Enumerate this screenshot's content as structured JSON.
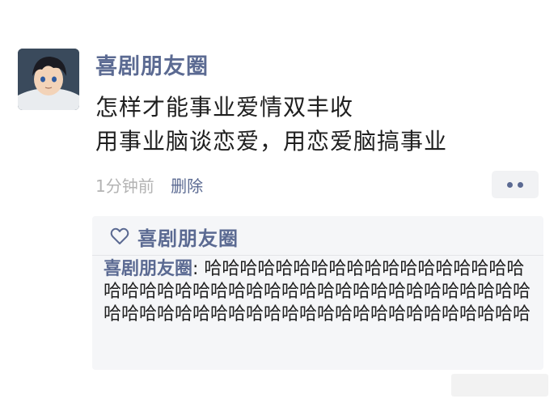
{
  "post": {
    "author": "喜剧朋友圈",
    "lines": [
      "怎样才能事业爱情双丰收",
      "用事业脑谈恋爱，用恋爱脑搞事业"
    ],
    "time": "1分钟前",
    "delete_label": "删除"
  },
  "likes": {
    "icon": "heart-outline-icon",
    "names": "喜剧朋友圈"
  },
  "comment": {
    "author": "喜剧朋友圈",
    "separator": ": ",
    "text": "哈哈哈哈哈哈哈哈哈哈哈哈哈哈哈哈哈哈哈哈哈哈哈哈哈哈哈哈哈哈哈哈哈哈哈哈哈哈哈哈哈哈哈哈哈哈哈哈哈哈哈哈哈哈哈哈哈哈哈哈哈哈哈哈哈哈"
  },
  "colors": {
    "accent": "#5b6a92",
    "meta": "#b3b3b3",
    "comment_bg": "#f5f6f8"
  }
}
